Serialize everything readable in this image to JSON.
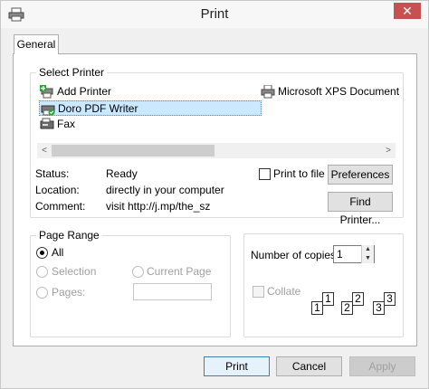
{
  "window": {
    "title": "Print",
    "close_glyph": "✕"
  },
  "tab": {
    "label": "General"
  },
  "select_printer": {
    "legend": "Select Printer",
    "printers": [
      {
        "name": "Add Printer",
        "icon": "add-printer-icon"
      },
      {
        "name": "Microsoft XPS Document",
        "icon": "printer-icon"
      },
      {
        "name": "Doro PDF Writer",
        "icon": "pdf-printer-icon",
        "selected": true
      },
      {
        "name": "Fax",
        "icon": "fax-icon"
      }
    ],
    "scroll_left": "<",
    "scroll_right": ">"
  },
  "status": {
    "status_label": "Status:",
    "status_value": "Ready",
    "location_label": "Location:",
    "location_value": "directly in your computer",
    "comment_label": "Comment:",
    "comment_value": "visit http://j.mp/the_sz"
  },
  "print_to_file": {
    "label": "Print to file",
    "checked": false
  },
  "buttons": {
    "preferences": "Preferences",
    "find_printer": "Find Printer...",
    "print": "Print",
    "cancel": "Cancel",
    "apply": "Apply"
  },
  "page_range": {
    "legend": "Page Range",
    "all": "All",
    "selection": "Selection",
    "current_page": "Current Page",
    "pages": "Pages:",
    "selected_option": "All"
  },
  "copies": {
    "label": "Number of copies:",
    "value": "1",
    "collate_label": "Collate",
    "collate_checked": false,
    "collate_pages": [
      "1",
      "1",
      "2",
      "2",
      "3",
      "3"
    ]
  },
  "colors": {
    "selection_bg": "#cce8ff",
    "selection_border": "#3399ff",
    "close_button": "#c75050",
    "default_button_border": "#3c7fb1"
  }
}
